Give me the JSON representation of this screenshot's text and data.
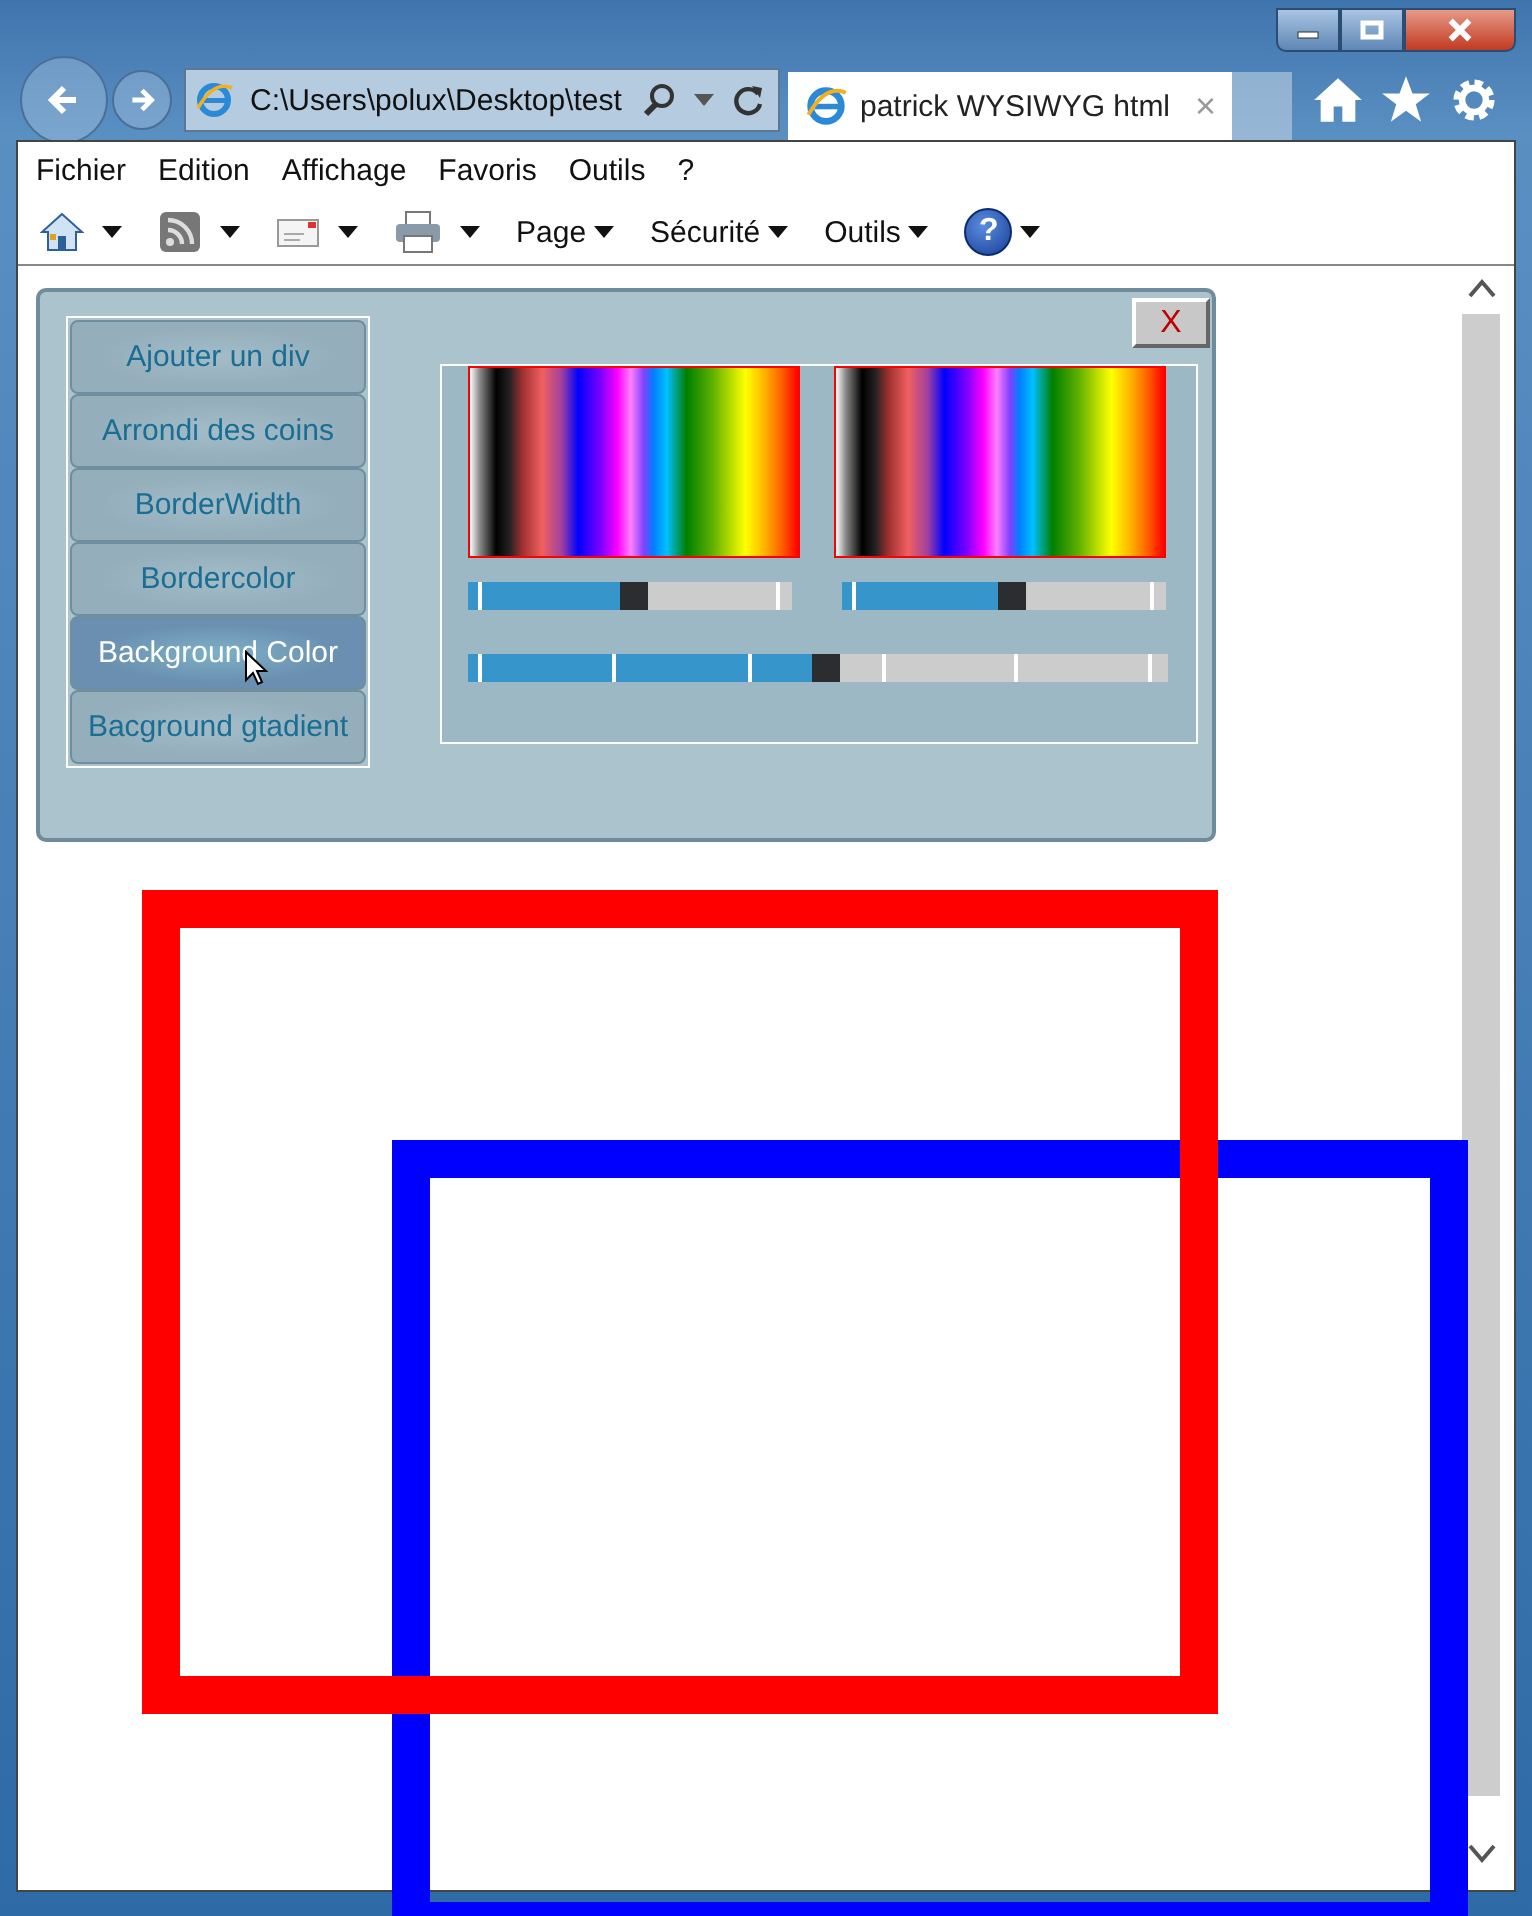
{
  "address_bar": {
    "value": "C:\\Users\\polux\\Desktop\\test"
  },
  "tabs": [
    {
      "label": "patrick WYSIWYG html",
      "close": "×",
      "selected": true
    }
  ],
  "menu": [
    "Fichier",
    "Edition",
    "Affichage",
    "Favoris",
    "Outils",
    "?"
  ],
  "toolbar": [
    {
      "kind": "icon"
    },
    {
      "kind": "icon"
    },
    {
      "kind": "icon"
    },
    {
      "kind": "icon"
    },
    {
      "kind": "menu",
      "label": "Page"
    },
    {
      "kind": "menu",
      "label": "Sécurité"
    },
    {
      "kind": "menu",
      "label": "Outils"
    },
    {
      "kind": "help",
      "label": "?"
    }
  ],
  "panel": {
    "close": "X",
    "buttons": [
      {
        "label": "Ajouter un div",
        "selected": false
      },
      {
        "label": "Arrondi des coins",
        "selected": false
      },
      {
        "label": "BorderWidth",
        "selected": false
      },
      {
        "label": "Bordercolor",
        "selected": false
      },
      {
        "label": "Background Color",
        "selected": true
      },
      {
        "label": "Bacground gtadient",
        "selected": false
      }
    ],
    "sliders": [
      {
        "level": 0.47
      },
      {
        "level": 0.48
      },
      {
        "level": 0.49
      }
    ]
  },
  "boxes": [
    {
      "color": "#0000ff"
    },
    {
      "color": "#ff0000"
    }
  ]
}
